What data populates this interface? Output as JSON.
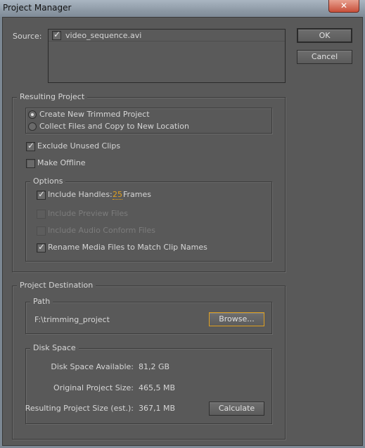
{
  "window": {
    "title": "Project Manager",
    "close_icon": "close-icon"
  },
  "source": {
    "label": "Source:",
    "items": [
      {
        "name": "video_sequence.avi",
        "checked": true
      }
    ]
  },
  "buttons": {
    "ok": "OK",
    "cancel": "Cancel",
    "browse": "Browse...",
    "calculate": "Calculate"
  },
  "resulting": {
    "title": "Resulting Project",
    "radios": [
      {
        "label": "Create New Trimmed Project",
        "selected": true
      },
      {
        "label": "Collect Files and Copy to New Location",
        "selected": false
      }
    ],
    "exclude_unused": {
      "label": "Exclude Unused Clips",
      "checked": true
    },
    "make_offline": {
      "label": "Make Offline",
      "checked": false
    },
    "options": {
      "title": "Options",
      "include_handles": {
        "label": "Include Handles:",
        "value": "25",
        "unit": "Frames",
        "checked": true
      },
      "include_preview": {
        "label": "Include Preview Files",
        "checked": false,
        "enabled": false
      },
      "include_audio": {
        "label": "Include Audio Conform Files",
        "checked": false,
        "enabled": false
      },
      "rename_media": {
        "label": "Rename Media Files to Match Clip Names",
        "checked": true
      }
    }
  },
  "destination": {
    "title": "Project Destination",
    "path": {
      "title": "Path",
      "value": "F:\\trimming_project"
    },
    "disk": {
      "title": "Disk Space",
      "available_label": "Disk Space Available:",
      "available": "81,2 GB",
      "original_label": "Original Project Size:",
      "original": "465,5 MB",
      "resulting_label": "Resulting Project Size (est.):",
      "resulting": "367,1 MB"
    }
  },
  "colors": {
    "accent": "#e0a020",
    "background": "#595959"
  }
}
